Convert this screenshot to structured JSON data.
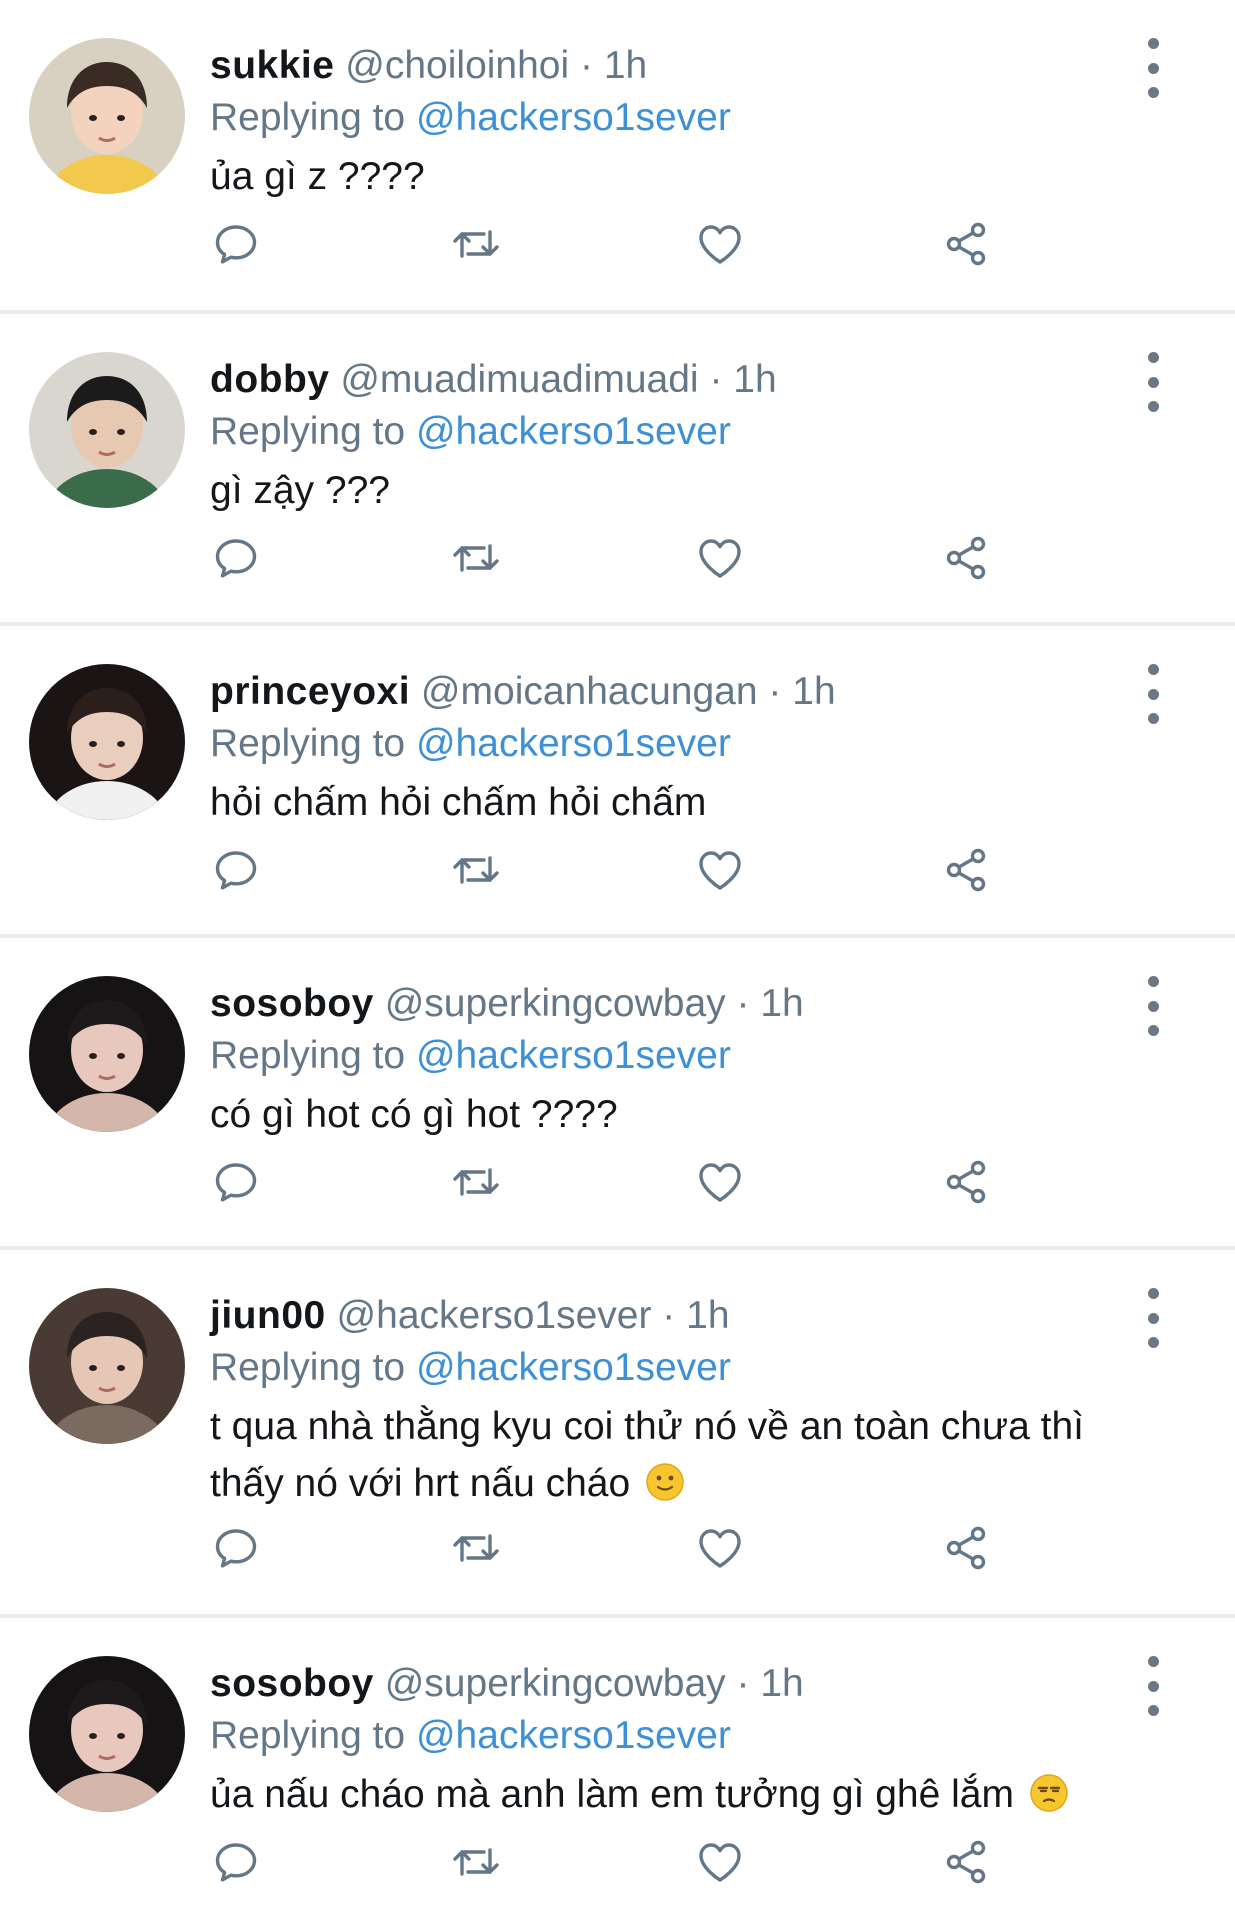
{
  "replying_label": "Replying to",
  "replies": [
    {
      "name": "sukkie",
      "handle": "@choiloinhoi",
      "separator": "·",
      "time": "1h",
      "replying_to": "@hackerso1sever",
      "text": "ủa gì z ????",
      "emoji": null,
      "avatar_colors": [
        "#d8d1c2",
        "#f2c94c",
        "#3a2b24",
        "#f3d3bd"
      ]
    },
    {
      "name": "dobby",
      "handle": "@muadimuadimuadi",
      "separator": "·",
      "time": "1h",
      "replying_to": "@hackerso1sever",
      "text": "gì zậy ???",
      "emoji": null,
      "avatar_colors": [
        "#d9d6cf",
        "#3a6b4a",
        "#1b1b1b",
        "#e7c9b2"
      ]
    },
    {
      "name": "princeyoxi",
      "handle": "@moicanhacungan",
      "separator": "·",
      "time": "1h",
      "replying_to": "@hackerso1sever",
      "text": "hỏi chấm hỏi chấm hỏi chấm",
      "emoji": null,
      "avatar_colors": [
        "#1a1414",
        "#f0f0f0",
        "#2b1f1c",
        "#e9cdbd"
      ]
    },
    {
      "name": "sosoboy",
      "handle": "@superkingcowbay",
      "separator": "·",
      "time": "1h",
      "replying_to": "@hackerso1sever",
      "text": "có gì hot có gì hot ????",
      "emoji": null,
      "avatar_colors": [
        "#151313",
        "#d4b7aa",
        "#1c1a1a",
        "#e8c8bd"
      ]
    },
    {
      "name": "jiun00",
      "handle": "@hackerso1sever",
      "separator": "·",
      "time": "1h",
      "replying_to": "@hackerso1sever",
      "text": "t qua nhà thằng kyu coi thử nó về an toàn chưa thì thấy nó với hrt nấu cháo",
      "emoji": "slightly-smiling-face",
      "avatar_colors": [
        "#4a3a34",
        "#7b6a60",
        "#2a2322",
        "#e6c7b5"
      ]
    },
    {
      "name": "sosoboy",
      "handle": "@superkingcowbay",
      "separator": "·",
      "time": "1h",
      "replying_to": "@hackerso1sever",
      "text": "ủa nấu cháo mà anh làm em tưởng gì ghê lắm",
      "emoji": "unamused-face",
      "avatar_colors": [
        "#151313",
        "#d4b7aa",
        "#1c1a1a",
        "#e8c8bd"
      ]
    }
  ],
  "action_icons": [
    "reply-icon",
    "retweet-icon",
    "like-icon",
    "share-icon"
  ],
  "colors": {
    "link": "#3d8fd6",
    "meta": "#657786",
    "text": "#14171a",
    "icon": "#657786",
    "divider": "#e6ecf0"
  }
}
